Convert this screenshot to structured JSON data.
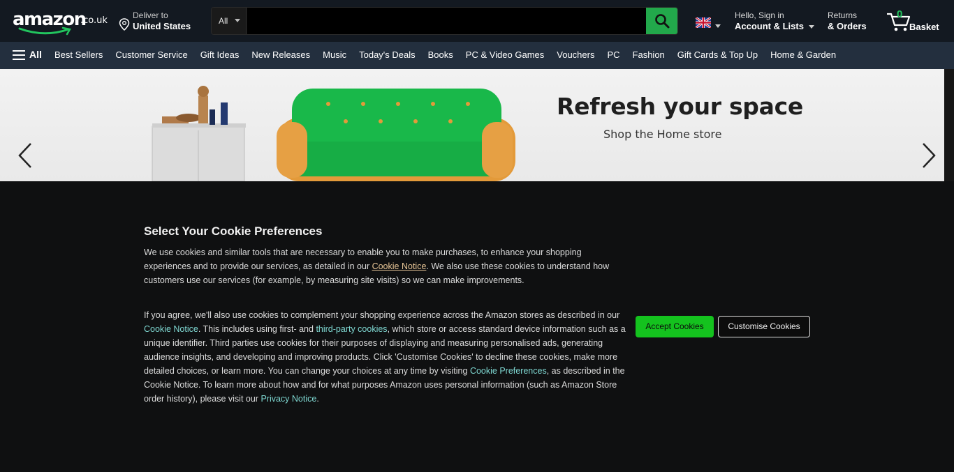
{
  "header": {
    "logo_word": "amazon",
    "logo_tld": ".co.uk",
    "deliver_line1": "Deliver to",
    "deliver_line2": "United States",
    "search_category": "All",
    "search_placeholder": "",
    "account_line1": "Hello, Sign in",
    "account_line2": "Account & Lists",
    "returns_line1": "Returns",
    "returns_line2": "& Orders",
    "cart_count": "0",
    "cart_label": "Basket"
  },
  "nav": {
    "all_label": "All",
    "links": [
      "Best Sellers",
      "Customer Service",
      "Gift Ideas",
      "New Releases",
      "Music",
      "Today's Deals",
      "Books",
      "PC & Video Games",
      "Vouchers",
      "PC",
      "Fashion",
      "Gift Cards & Top Up",
      "Home & Garden"
    ]
  },
  "hero": {
    "title": "Refresh your space",
    "subtitle": "Shop the Home store"
  },
  "cookie": {
    "title": "Select Your Cookie Preferences",
    "p1_a": "We use cookies and similar tools that are necessary to enable you to make purchases, to enhance your shopping experiences and to provide our services, as detailed in our ",
    "p1_link": "Cookie Notice",
    "p1_b": ". We also use these cookies to understand how customers use our services (for example, by measuring site visits) so we can make improvements.",
    "p2_a": "If you agree, we'll also use cookies to complement your shopping experience across the Amazon stores as described in our ",
    "p2_link1": "Cookie Notice",
    "p2_b": ". This includes using first- and ",
    "p2_link2": "third-party cookies",
    "p2_c": ", which store or access standard device information such as a unique identifier. Third parties use cookies for their purposes of displaying and measuring personalised ads, generating audience insights, and developing and improving products. Click 'Customise Cookies' to decline these cookies, make more detailed choices, or learn more. You can change your choices at any time by visiting ",
    "p2_link3": "Cookie Preferences",
    "p2_d": ", as described in the Cookie Notice. To learn more about how and for what purposes Amazon uses personal information (such as Amazon Store order history), please visit our ",
    "p2_link4": "Privacy Notice",
    "p2_e": ".",
    "accept_label": "Accept Cookies",
    "customise_label": "Customise Cookies"
  },
  "colors": {
    "header_bg": "#131921",
    "nav_bg": "#232f3e",
    "accent_green": "#14c21e",
    "search_button": "#22a84b",
    "link_teal": "#7fd8d2"
  }
}
